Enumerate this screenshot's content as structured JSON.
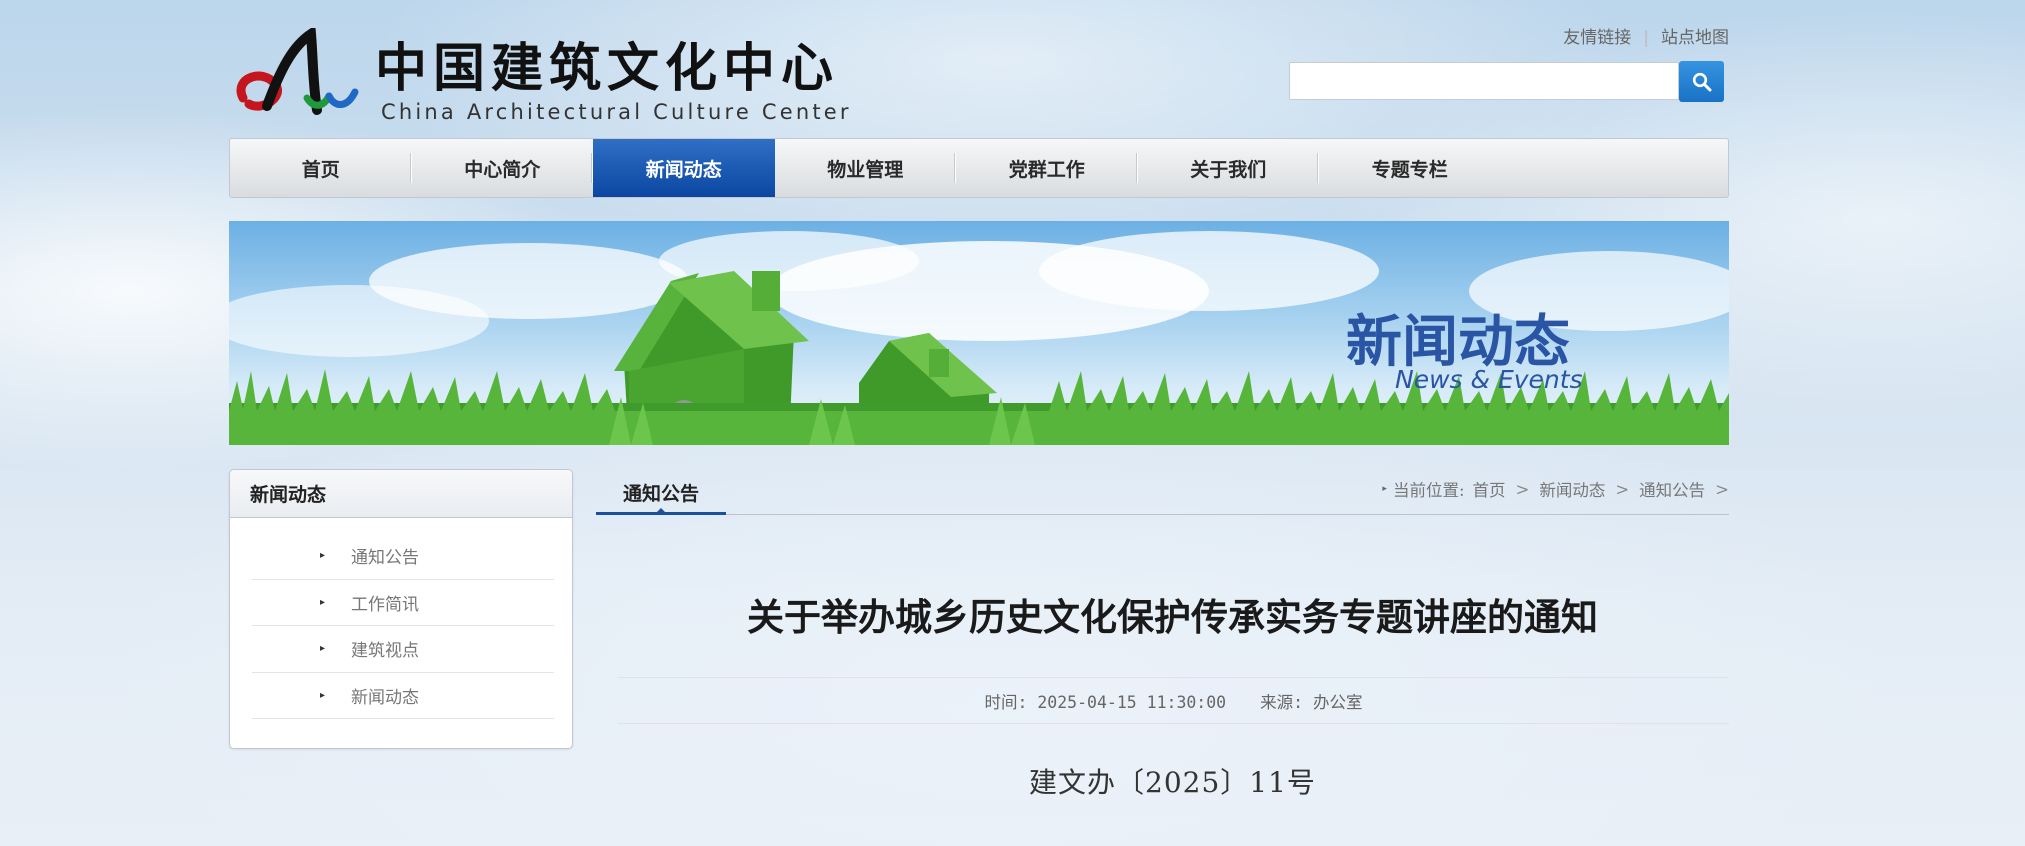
{
  "header": {
    "logo_cn": "中国建筑文化中心",
    "logo_en": "China Architectural Culture Center",
    "links": [
      "友情链接",
      "站点地图"
    ],
    "search_placeholder": ""
  },
  "nav": {
    "items": [
      "首页",
      "中心简介",
      "新闻动态",
      "物业管理",
      "党群工作",
      "关于我们",
      "专题专栏"
    ],
    "active_index": 2
  },
  "banner": {
    "title": "新闻动态",
    "subtitle": "News & Events"
  },
  "sidebar": {
    "title": "新闻动态",
    "items": [
      "通知公告",
      "工作简讯",
      "建筑视点",
      "新闻动态"
    ]
  },
  "content": {
    "tab": "通知公告",
    "breadcrumb": {
      "label": "当前位置:",
      "items": [
        "首页",
        "新闻动态",
        "通知公告"
      ]
    },
    "article": {
      "title": "关于举办城乡历史文化保护传承实务专题讲座的通知",
      "time": "时间: 2025-04-15 11:30:00",
      "source": "来源: 办公室",
      "doc_number": "建文办〔2025〕11号"
    }
  },
  "colors": {
    "nav_active": "#0b47a2",
    "search_button": "#1a72c6",
    "banner_title": "#2a55a5",
    "tab_underline": "#1c4f9d"
  }
}
